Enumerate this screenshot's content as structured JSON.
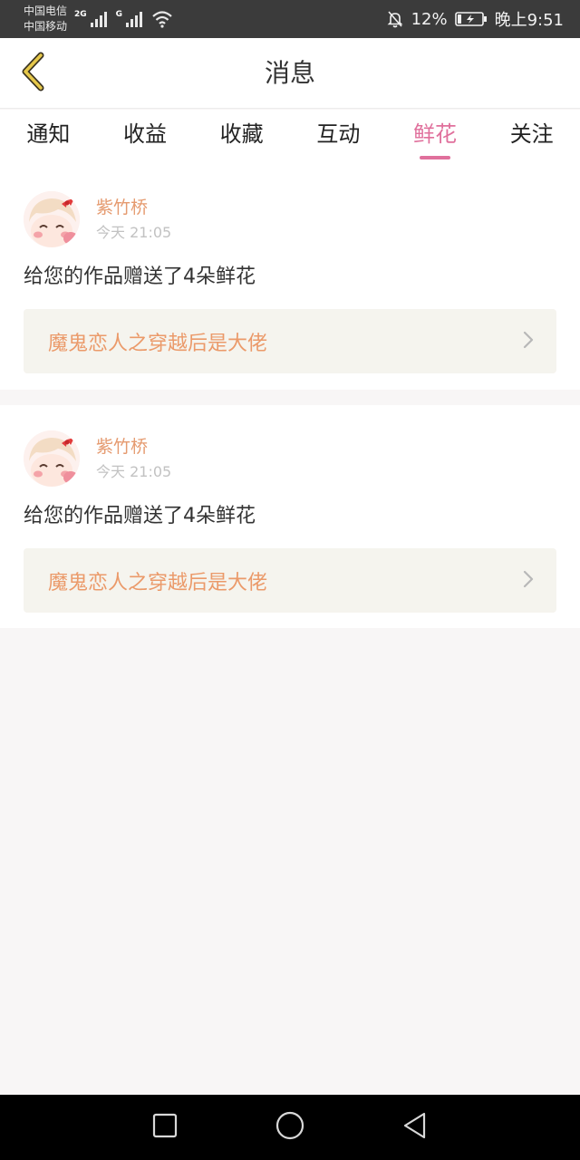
{
  "status_bar": {
    "carrier_1": "中国电信",
    "carrier_2": "中国移动",
    "network_1": "2G",
    "network_2": "G",
    "battery": "12%",
    "time": "晚上9:51"
  },
  "header": {
    "title": "消息"
  },
  "tabs": [
    {
      "label": "通知"
    },
    {
      "label": "收益"
    },
    {
      "label": "收藏"
    },
    {
      "label": "互动"
    },
    {
      "label": "鲜花"
    },
    {
      "label": "关注"
    }
  ],
  "active_tab": "鲜花",
  "messages": [
    {
      "sender": "紫竹桥",
      "time": "今天 21:05",
      "text": "给您的作品赠送了4朵鲜花",
      "work_title": "魔鬼恋人之穿越后是大佬"
    },
    {
      "sender": "紫竹桥",
      "time": "今天 21:05",
      "text": "给您的作品赠送了4朵鲜花",
      "work_title": "魔鬼恋人之穿越后是大佬"
    }
  ],
  "colors": {
    "accent": "#e0709c",
    "name": "#e59a6f",
    "link_bg": "#f5f4ee"
  },
  "icons": {
    "back": "chevron-left-icon",
    "link_arrow": "chevron-right-icon",
    "nav_recent": "square-icon",
    "nav_home": "circle-icon",
    "nav_back": "triangle-back-icon"
  }
}
